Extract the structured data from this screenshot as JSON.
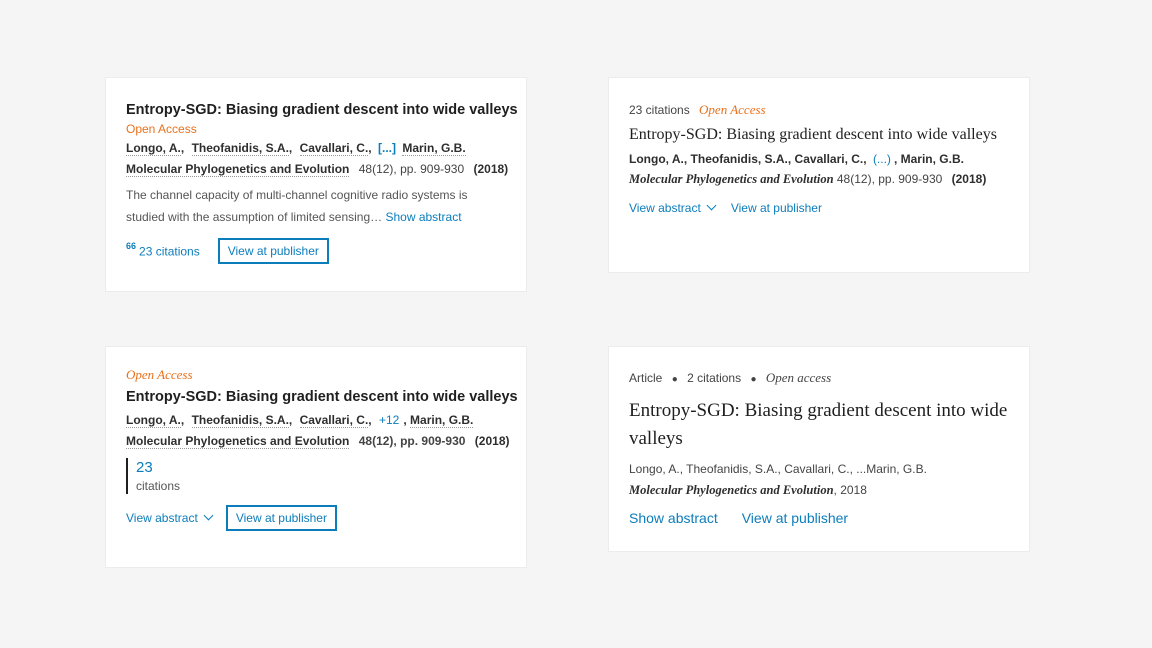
{
  "card1": {
    "title": "Entropy-SGD: Biasing gradient descent into wide valleys",
    "open_access": "Open Access",
    "authors": [
      "Longo, A.",
      "Theofanidis, S.A.",
      "Cavallari, C."
    ],
    "more": "[...]",
    "last_author": "Marin, G.B.",
    "journal": "Molecular Phylogenetics and Evolution",
    "volume": "48(12), pp. 909-930",
    "year": "(2018)",
    "abstract": "The channel capacity of multi-channel cognitive radio systems is studied with the assumption of limited sensing…",
    "show_abstract": "Show abstract",
    "quote_icon": "66",
    "citations": "23 citations",
    "view_publisher": "View at publisher"
  },
  "card2": {
    "citations": "23 citations",
    "open_access": "Open Access",
    "title": "Entropy-SGD: Biasing gradient descent into wide valleys",
    "authors": "Longo, A., Theofanidis, S.A., Cavallari, C.,",
    "more": "(...)",
    "last_author": "Marin, G.B.",
    "journal": "Molecular Phylogenetics and Evolution",
    "volume": "48(12), pp. 909-930",
    "year": "(2018)",
    "view_abstract": "View abstract",
    "view_publisher": "View at publisher"
  },
  "card3": {
    "open_access": "Open Access",
    "title": "Entropy-SGD: Biasing gradient descent into wide valleys",
    "authors": [
      "Longo, A.",
      "Theofanidis, S.A.",
      "Cavallari, C."
    ],
    "more": "+12",
    "last_author": "Marin, G.B.",
    "journal": "Molecular Phylogenetics and Evolution",
    "volume": "48(12), pp. 909-930",
    "year": "(2018)",
    "citation_count": "23",
    "citation_word": "citations",
    "view_abstract": "View abstract",
    "view_publisher": "View at publisher"
  },
  "card4": {
    "type": "Article",
    "citations": "2 citations",
    "open_access": "Open access",
    "title": "Entropy-SGD: Biasing gradient descent into wide valleys",
    "authors": "Longo, A., Theofanidis, S.A., Cavallari, C., ...Marin, G.B.",
    "journal": "Molecular Phylogenetics and Evolution",
    "year": ", 2018",
    "show_abstract": "Show abstract",
    "view_publisher": "View at publisher"
  },
  "colors": {
    "accent": "#0c7dbb",
    "open_access": "#e9711c"
  }
}
